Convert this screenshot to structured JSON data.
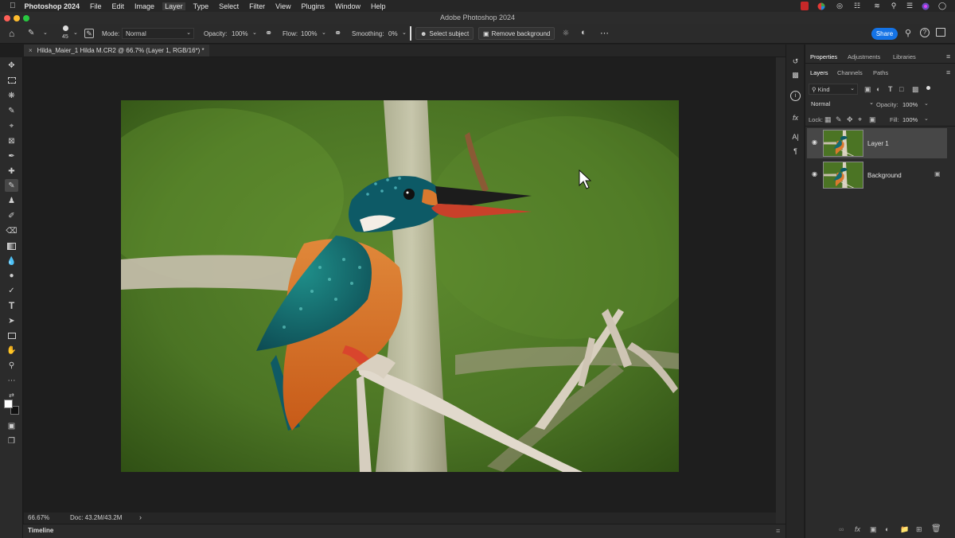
{
  "menubar": {
    "app_name": "Photoshop 2024",
    "items": [
      "File",
      "Edit",
      "Image",
      "Layer",
      "Type",
      "Select",
      "Filter",
      "View",
      "Plugins",
      "Window",
      "Help"
    ],
    "active_item": "Layer"
  },
  "window": {
    "title": "Adobe Photoshop 2024"
  },
  "options": {
    "brush_size": "45",
    "mode_label": "Mode:",
    "mode_value": "Normal",
    "opacity_label": "Opacity:",
    "opacity_value": "100%",
    "flow_label": "Flow:",
    "flow_value": "100%",
    "smoothing_label": "Smoothing:",
    "smoothing_value": "0%",
    "select_subject": "Select subject",
    "remove_background": "Remove background",
    "share": "Share"
  },
  "document": {
    "tab_title": "Hilda_Maier_1 Hilda M.CR2 @ 66.7% (Layer 1, RGB/16*) *"
  },
  "status": {
    "zoom": "66.67%",
    "doc": "Doc: 43.2M/43.2M"
  },
  "timeline": {
    "label": "Timeline"
  },
  "panel": {
    "top_tabs": [
      "Properties",
      "Adjustments",
      "Libraries"
    ],
    "sub_tabs": [
      "Layers",
      "Channels",
      "Paths"
    ],
    "filter_kind": "Kind",
    "blend_mode": "Normal",
    "opacity_label": "Opacity:",
    "opacity_value": "100%",
    "lock_label": "Lock:",
    "fill_label": "Fill:",
    "fill_value": "100%",
    "layers": [
      {
        "name": "Layer 1",
        "selected": true
      },
      {
        "name": "Background",
        "selected": false
      }
    ]
  },
  "colors": {
    "accent": "#1473e6",
    "panel_bg": "#2b2b2b",
    "canvas_bg": "#1e1e1e"
  }
}
